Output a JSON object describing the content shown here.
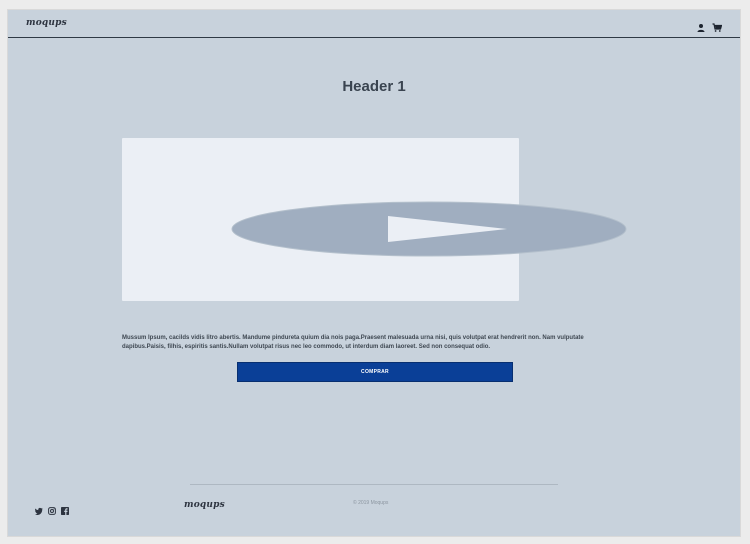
{
  "header": {
    "logo": "moqups",
    "icons": [
      "user-icon",
      "cart-icon"
    ]
  },
  "main": {
    "title": "Header 1",
    "description": "Mussum Ipsum, cacilds vidis litro abertis. Mandume pindureta quium dia nois paga.Praesent malesuada urna nisi, quis volutpat erat hendrerit non. Nam vulputate dapibus.Paisis, filhis, espiritis santis.Nullam volutpat risus nec leo commodo, ut interdum diam laoreet. Sed non consequat odio.",
    "cta_label": "COMPRAR"
  },
  "footer": {
    "logo": "moqups",
    "social_icons": [
      "twitter-icon",
      "instagram-icon",
      "facebook-icon"
    ],
    "copyright": "© 2019  Moqups"
  },
  "colors": {
    "frame_bg": "#c8d2dc",
    "card_bg": "#ebeff5",
    "play_shape": "#a0aec0",
    "cta_bg": "#0a3f97"
  }
}
